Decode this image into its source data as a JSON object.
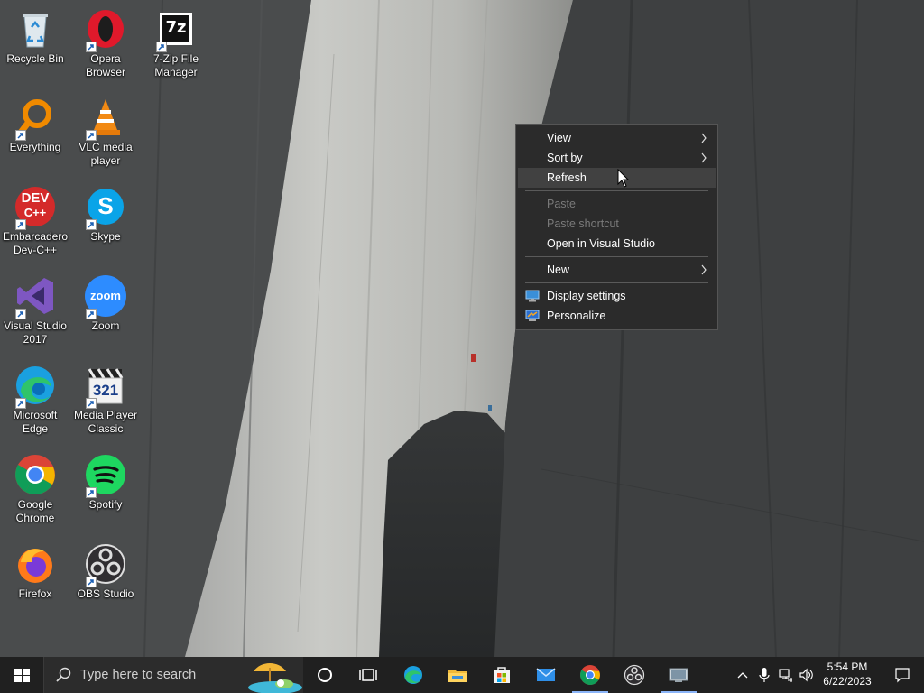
{
  "desktop": {
    "icons": [
      {
        "label": "Recycle Bin",
        "icon": "recycle-bin-icon"
      },
      {
        "label": "Opera Browser",
        "icon": "opera-icon"
      },
      {
        "label": "7-Zip File Manager",
        "icon": "7zip-icon",
        "badge": "7z"
      },
      {
        "label": "Everything",
        "icon": "everything-icon"
      },
      {
        "label": "VLC media player",
        "icon": "vlc-icon"
      },
      {
        "label": "Embarcadero Dev-C++",
        "icon": "devcpp-icon",
        "badge_top": "DEV",
        "badge_bottom": "C++"
      },
      {
        "label": "Skype",
        "icon": "skype-icon",
        "badge": "S"
      },
      {
        "label": "Visual Studio 2017",
        "icon": "visual-studio-icon"
      },
      {
        "label": "Zoom",
        "icon": "zoom-icon",
        "badge": "zoom"
      },
      {
        "label": "Microsoft Edge",
        "icon": "edge-icon"
      },
      {
        "label": "Media Player Classic",
        "icon": "media-player-classic-icon",
        "badge": "321"
      },
      {
        "label": "Google Chrome",
        "icon": "chrome-icon"
      },
      {
        "label": "Spotify",
        "icon": "spotify-icon"
      },
      {
        "label": "Firefox",
        "icon": "firefox-icon"
      },
      {
        "label": "OBS Studio",
        "icon": "obs-icon"
      }
    ]
  },
  "context_menu": {
    "items": [
      {
        "label": "View",
        "submenu": true,
        "enabled": true
      },
      {
        "label": "Sort by",
        "submenu": true,
        "enabled": true
      },
      {
        "label": "Refresh",
        "submenu": false,
        "enabled": true,
        "hover": true
      },
      {
        "label": "Paste",
        "enabled": false
      },
      {
        "label": "Paste shortcut",
        "enabled": false
      },
      {
        "label": "Open in Visual Studio",
        "enabled": true
      },
      {
        "label": "New",
        "submenu": true,
        "enabled": true
      },
      {
        "label": "Display settings",
        "enabled": true,
        "icon": "display-settings-icon"
      },
      {
        "label": "Personalize",
        "enabled": true,
        "icon": "personalize-icon"
      }
    ]
  },
  "taskbar": {
    "search_placeholder": "Type here to search",
    "apps": [
      "cortana-icon",
      "task-view-icon",
      "edge-icon",
      "file-explorer-icon",
      "microsoft-store-icon",
      "mail-icon",
      "chrome-icon",
      "obs-icon",
      "remote-desktop-icon"
    ],
    "time": "5:54 PM",
    "date": "6/22/2023"
  },
  "colors": {
    "taskbar_bg": "#202020",
    "menu_bg": "#2b2b2b",
    "menu_hover": "#414141",
    "menu_disabled_text": "#7a7a7a"
  }
}
